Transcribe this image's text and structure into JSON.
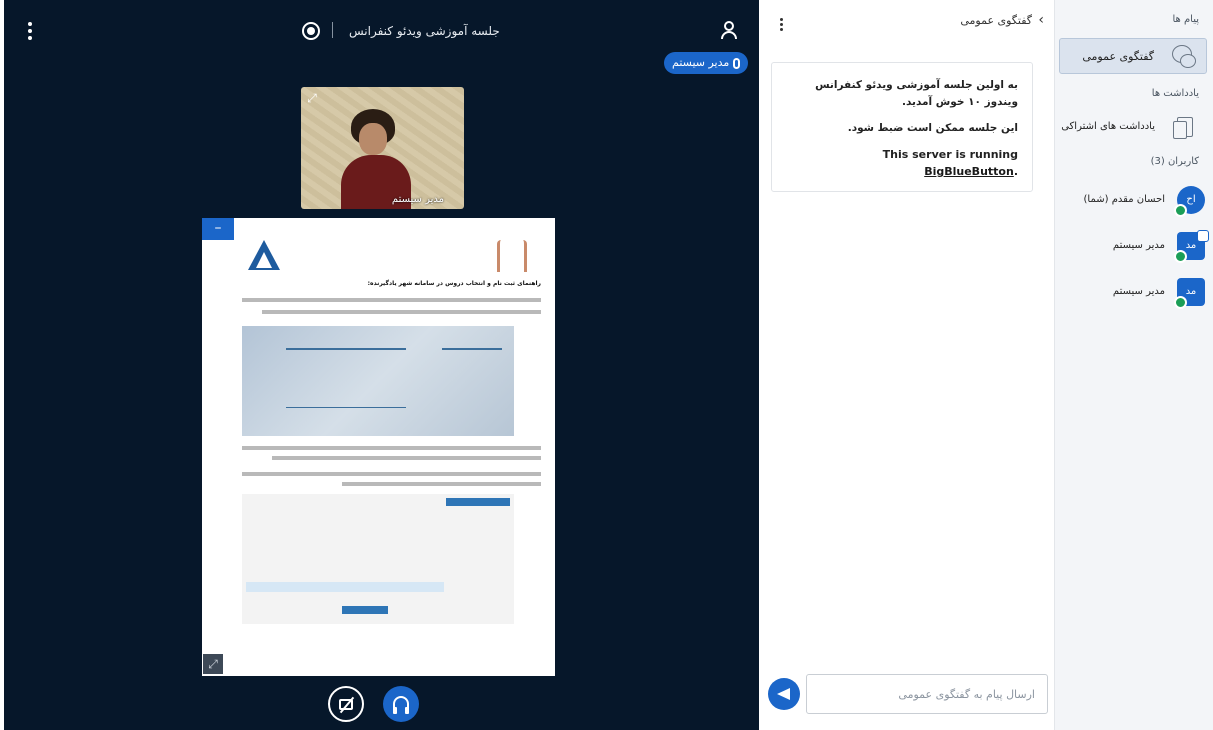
{
  "stage": {
    "meeting_title": "جلسه آموزشی ویدئو کنفرانس",
    "talker_name": "مدیر سیستم",
    "webcam_name": "مدیر سیستم",
    "slide_heading": "راهنمای ثبت نام و انتخاب دروس در سامانه شهر یادگیرنده:"
  },
  "chat": {
    "title": "گفتگوی عمومی",
    "messages": {
      "welcome": "به اولین جلسه آموزشی ویدئو کنفرانس ویندوز ۱۰ خوش آمدید.",
      "recording": "این جلسه ممکن است ضبط شود.",
      "server_prefix": "This server is running ",
      "server_link": "BigBlueButton",
      "server_suffix": "."
    },
    "input_placeholder": "ارسال پیام به گفتگوی عمومی"
  },
  "userlist": {
    "messages_header": "پیام ها",
    "public_chat_label": "گفتگوی عمومی",
    "notes_header": "یادداشت ها",
    "shared_notes_label": "یادداشت های اشتراکی",
    "users_header": "کاربران (3)",
    "users": [
      {
        "initials": "اح",
        "name": "احسان مقدم (شما)"
      },
      {
        "initials": "مد",
        "name": "مدیر سیستم"
      },
      {
        "initials": "مد",
        "name": "مدیر سیستم"
      }
    ]
  },
  "colors": {
    "stage_bg": "#06172a",
    "accent": "#1b66c9",
    "panel_bg": "#f3f5f8",
    "audio_badge": "#1b9e57"
  },
  "icons": [
    "menu-dots-icon",
    "record-icon",
    "user-icon",
    "microphone-icon",
    "expand-icon",
    "minimize-icon",
    "camera-off-icon",
    "headphones-icon",
    "send-icon",
    "chat-bubble-icon",
    "document-icon",
    "back-chevron-icon"
  ]
}
